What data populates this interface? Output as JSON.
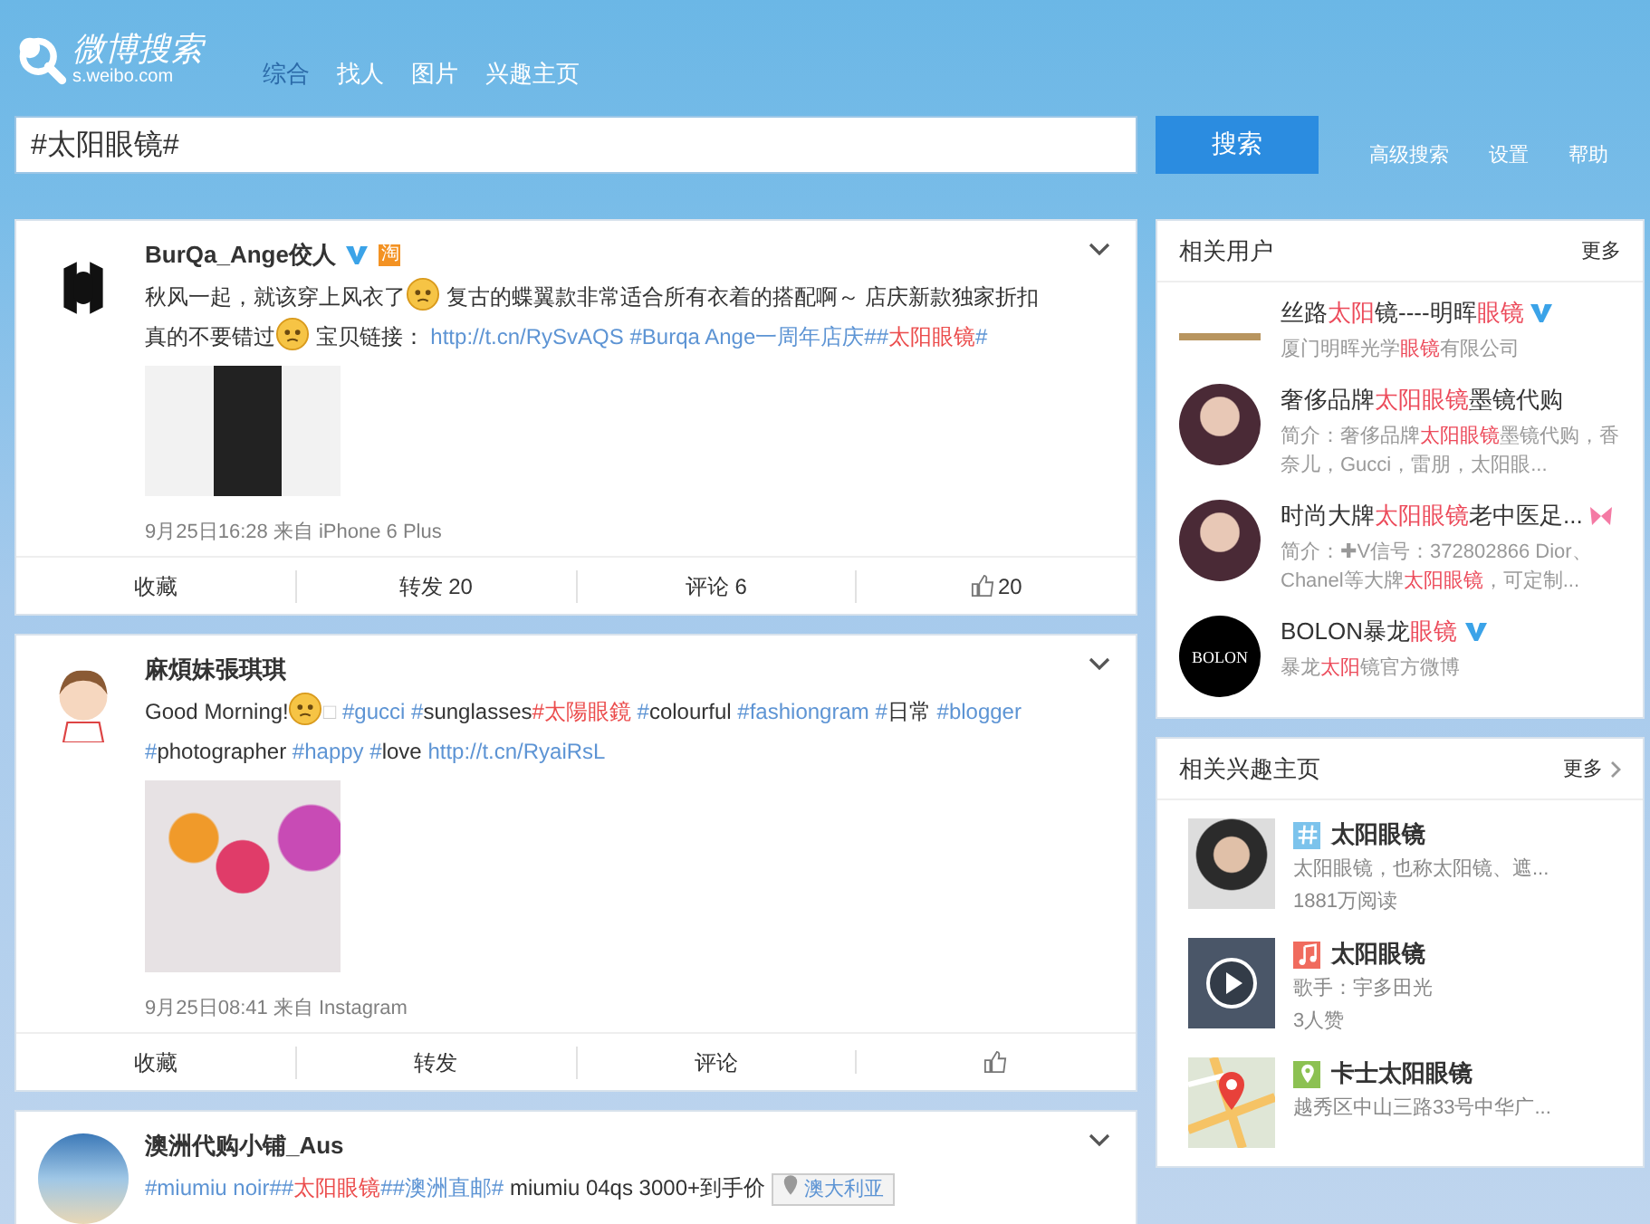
{
  "header": {
    "logo_title": "微博搜索",
    "logo_subtitle": "s.weibo.com"
  },
  "nav": [
    {
      "label": "综合",
      "selected": true
    },
    {
      "label": "找人",
      "selected": false
    },
    {
      "label": "图片",
      "selected": false
    },
    {
      "label": "兴趣主页",
      "selected": false
    }
  ],
  "search": {
    "value": "#太阳眼镜#",
    "button": "搜索"
  },
  "top_links": [
    "高级搜索",
    "设置",
    "帮助"
  ],
  "posts": [
    {
      "author": "BurQa_Ange佼人",
      "badges": [
        {
          "kind": "verified"
        },
        {
          "kind": "shop",
          "text": "淘"
        }
      ],
      "segments": [
        {
          "kind": "text",
          "text": "秋风一起，就该穿上风衣了"
        },
        {
          "kind": "emoji"
        },
        {
          "kind": "text",
          "text": " 复古的蝶翼款非常适合所有衣着的搭配啊～ 店庆新款独家折扣真的不要错过"
        },
        {
          "kind": "emoji"
        },
        {
          "kind": "text",
          "text": " 宝贝链接： "
        },
        {
          "kind": "link",
          "text": "http://t.cn/RySvAQS"
        },
        {
          "kind": "link",
          "text": "#Burqa Ange一周年店庆#",
          "space_before": true
        },
        {
          "kind": "link",
          "text": "#"
        },
        {
          "kind": "hit",
          "text": "太阳眼镜"
        },
        {
          "kind": "link",
          "text": "#"
        }
      ],
      "meta": "9月25日16:28 来自 iPhone 6 Plus",
      "actions": [
        {
          "kind": "text",
          "label": "收藏"
        },
        {
          "kind": "text",
          "label": "转发 20"
        },
        {
          "kind": "text",
          "label": "评论 6"
        },
        {
          "kind": "like",
          "label": "20"
        }
      ]
    },
    {
      "author": "麻煩妹張琪琪",
      "segments": [
        {
          "kind": "text",
          "text": "Good Morning!"
        },
        {
          "kind": "emoji"
        },
        {
          "kind": "muted",
          "text": "□"
        },
        {
          "kind": "link",
          "text": "#gucci",
          "space_before": true
        },
        {
          "kind": "link",
          "text": "#",
          "space_before": true
        },
        {
          "kind": "text",
          "text": "sunglasses"
        },
        {
          "kind": "hit",
          "text": "#太陽眼鏡"
        },
        {
          "kind": "link",
          "text": "#",
          "space_before": true
        },
        {
          "kind": "text",
          "text": "colourful "
        },
        {
          "kind": "link",
          "text": "#fashiongram"
        },
        {
          "kind": "link",
          "text": "#",
          "space_before": true
        },
        {
          "kind": "text",
          "text": "日常 "
        },
        {
          "kind": "link",
          "text": "#blogger"
        },
        {
          "kind": "link",
          "text": "#",
          "space_before": true
        },
        {
          "kind": "text",
          "text": "photographer "
        },
        {
          "kind": "link",
          "text": "#happy"
        },
        {
          "kind": "link",
          "text": "#",
          "space_before": true
        },
        {
          "kind": "text",
          "text": "love "
        },
        {
          "kind": "link",
          "text": "http://t.cn/RyaiRsL"
        }
      ],
      "meta": "9月25日08:41 来自 Instagram",
      "actions": [
        {
          "kind": "text",
          "label": "收藏"
        },
        {
          "kind": "text",
          "label": "转发"
        },
        {
          "kind": "text",
          "label": "评论"
        },
        {
          "kind": "like"
        }
      ]
    },
    {
      "author": "澳洲代购小铺_Aus",
      "segments": [
        {
          "kind": "link",
          "text": "#miumiu noir#"
        },
        {
          "kind": "link",
          "text": "#"
        },
        {
          "kind": "hit",
          "text": "太阳眼镜"
        },
        {
          "kind": "link",
          "text": "#"
        },
        {
          "kind": "link",
          "text": "#澳洲直邮#"
        },
        {
          "kind": "text",
          "text": " miumiu 04qs 3000+到手价 "
        },
        {
          "kind": "place",
          "text": "澳大利亚"
        }
      ]
    }
  ],
  "related_users": {
    "title": "相关用户",
    "more": "更多",
    "items": [
      {
        "name": [
          {
            "text": "丝路",
            "hit": false
          },
          {
            "text": "太阳",
            "hit": true
          },
          {
            "text": "镜----明晖",
            "hit": false
          },
          {
            "text": "眼镜",
            "hit": true
          }
        ],
        "badges": [
          {
            "kind": "verified"
          }
        ],
        "desc": [
          {
            "text": "厦门明晖光学",
            "hit": false
          },
          {
            "text": "眼镜",
            "hit": true
          },
          {
            "text": "有限公司",
            "hit": false
          }
        ]
      },
      {
        "name": [
          {
            "text": "奢侈品牌",
            "hit": false
          },
          {
            "text": "太阳眼镜",
            "hit": true
          },
          {
            "text": "墨镜代购",
            "hit": false
          }
        ],
        "desc": [
          {
            "text": "简介：奢侈品牌",
            "hit": false
          },
          {
            "text": "太阳眼镜",
            "hit": true
          },
          {
            "text": "墨镜代购，香奈儿，Gucci，雷朋，太阳眼...",
            "hit": false
          }
        ]
      },
      {
        "name": [
          {
            "text": "时尚大牌",
            "hit": false
          },
          {
            "text": "太阳眼镜",
            "hit": true
          },
          {
            "text": "老中医足...",
            "hit": false
          }
        ],
        "badges": [
          {
            "kind": "butterfly"
          }
        ],
        "desc": [
          {
            "text": "简介：✚V信号：372802866 Dior、Chanel等大牌",
            "hit": false
          },
          {
            "text": "太阳眼镜",
            "hit": true
          },
          {
            "text": "，可定制...",
            "hit": false
          }
        ]
      },
      {
        "avatar_text": "BOLON",
        "name": [
          {
            "text": "BOLON暴龙",
            "hit": false
          },
          {
            "text": "眼镜",
            "hit": true
          }
        ],
        "badges": [
          {
            "kind": "verified"
          }
        ],
        "desc": [
          {
            "text": "暴龙",
            "hit": false
          },
          {
            "text": "太阳",
            "hit": true
          },
          {
            "text": "镜官方微博",
            "hit": false
          }
        ]
      }
    ]
  },
  "related_pages": {
    "title": "相关兴趣主页",
    "more": "更多",
    "items": [
      {
        "kind": "topic",
        "title": "太阳眼镜",
        "lines": [
          "太阳眼镜，也称太阳镜、遮...",
          "1881万阅读"
        ]
      },
      {
        "kind": "music",
        "title": "太阳眼镜",
        "lines": [
          "歌手：宇多田光",
          "3人赞"
        ]
      },
      {
        "kind": "place",
        "title": "卡士太阳眼镜",
        "lines": [
          "越秀区中山三路33号中华广..."
        ]
      }
    ]
  }
}
